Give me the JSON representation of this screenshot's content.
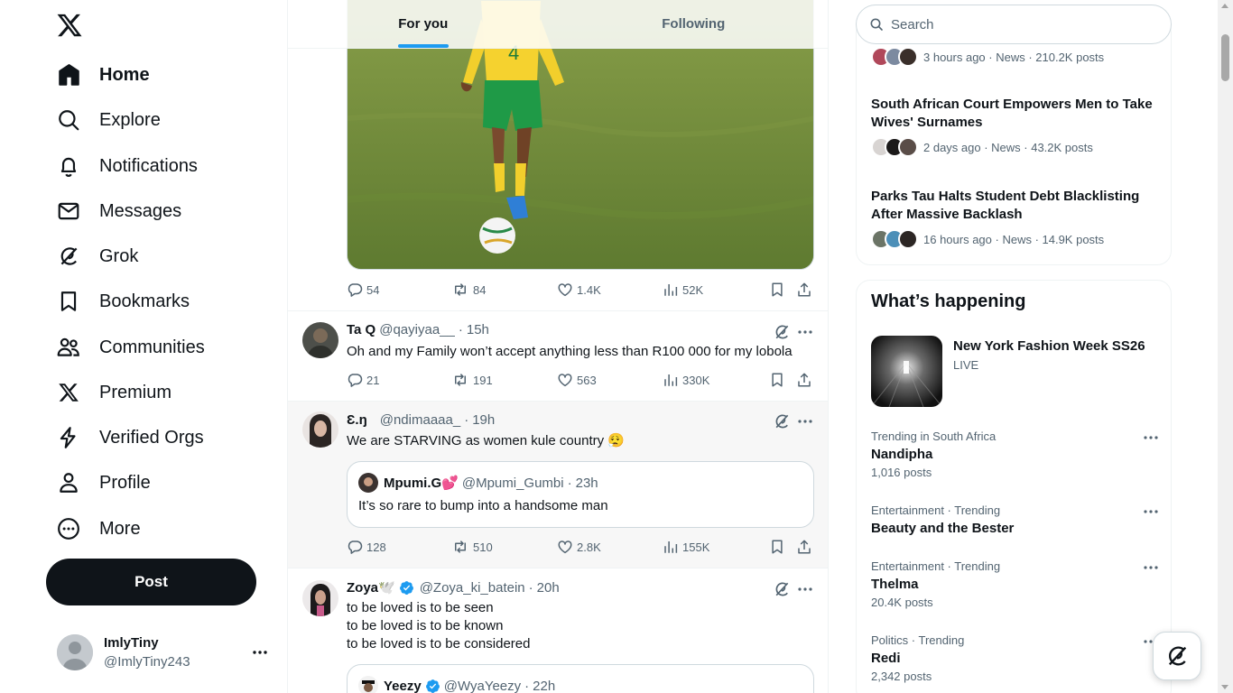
{
  "nav": {
    "items": [
      {
        "label": "Home",
        "icon": "home-icon"
      },
      {
        "label": "Explore",
        "icon": "search-icon"
      },
      {
        "label": "Notifications",
        "icon": "bell-icon"
      },
      {
        "label": "Messages",
        "icon": "envelope-icon"
      },
      {
        "label": "Grok",
        "icon": "grok-icon"
      },
      {
        "label": "Bookmarks",
        "icon": "bookmark-icon"
      },
      {
        "label": "Communities",
        "icon": "people-icon"
      },
      {
        "label": "Premium",
        "icon": "x-logo-icon"
      },
      {
        "label": "Verified Orgs",
        "icon": "lightning-icon"
      },
      {
        "label": "Profile",
        "icon": "person-icon"
      },
      {
        "label": "More",
        "icon": "more-circle-icon"
      }
    ],
    "post_label": "Post"
  },
  "account": {
    "name": "ImlyTiny",
    "handle": "@ImlyTiny243"
  },
  "tabs": [
    {
      "label": "For you",
      "active": true
    },
    {
      "label": "Following",
      "active": false
    }
  ],
  "feed": {
    "first": {
      "reply": "54",
      "retweet": "84",
      "like": "1.4K",
      "views": "52K"
    },
    "tweets": [
      {
        "name": "Ta Q",
        "handle": "@qayiyaa__",
        "time": "15h",
        "text": "Oh and my Family won’t accept anything less than R100 000 for my lobola",
        "reply": "21",
        "retweet": "191",
        "like": "563",
        "views": "330K"
      },
      {
        "name": "Ɛ.ŋ",
        "handle": "@ndimaaaa_",
        "time": "19h",
        "text": "We are STARVING as women kule country 😮‍💨",
        "quote": {
          "name": "Mpumi.G💕",
          "handle": "@Mpumi_Gumbi",
          "time": "23h",
          "text": "It’s so rare to bump into a handsome man"
        },
        "reply": "128",
        "retweet": "510",
        "like": "2.8K",
        "views": "155K"
      },
      {
        "name": "Zoya🕊️",
        "handle": "@Zoya_ki_batein",
        "time": "20h",
        "lines": [
          "to be loved is to be seen",
          "to be loved is to be known",
          "to be loved is to be considered"
        ],
        "quote": {
          "name": "Yeezy",
          "handle": "@WyaYeezy",
          "time": "22h"
        }
      }
    ]
  },
  "search": {
    "placeholder": "Search"
  },
  "news": [
    {
      "meta": "3 hours ago · News · 210.2K posts"
    },
    {
      "title": "South African Court Empowers Men to Take Wives' Surnames",
      "meta": "2 days ago · News · 43.2K posts"
    },
    {
      "title": "Parks Tau Halts Student Debt Blacklisting After Massive Backlash",
      "meta": "16 hours ago · News · 14.9K posts"
    }
  ],
  "happening": {
    "title": "What’s happening",
    "event": {
      "title": "New York Fashion Week SS26",
      "status": "LIVE"
    },
    "trends": [
      {
        "context": "Trending in South Africa",
        "name": "Nandipha",
        "count": "1,016 posts"
      },
      {
        "context": "Entertainment · Trending",
        "name": "Beauty and the Bester",
        "count": ""
      },
      {
        "context": "Entertainment · Trending",
        "name": "Thelma",
        "count": "20.4K posts"
      },
      {
        "context": "Politics · Trending",
        "name": "Redi",
        "count": "2,342 posts"
      }
    ]
  },
  "colors": {
    "accent": "#1d9bf0",
    "text": "#0f1419",
    "muted": "#536471",
    "verified": "#1d9bf0"
  }
}
